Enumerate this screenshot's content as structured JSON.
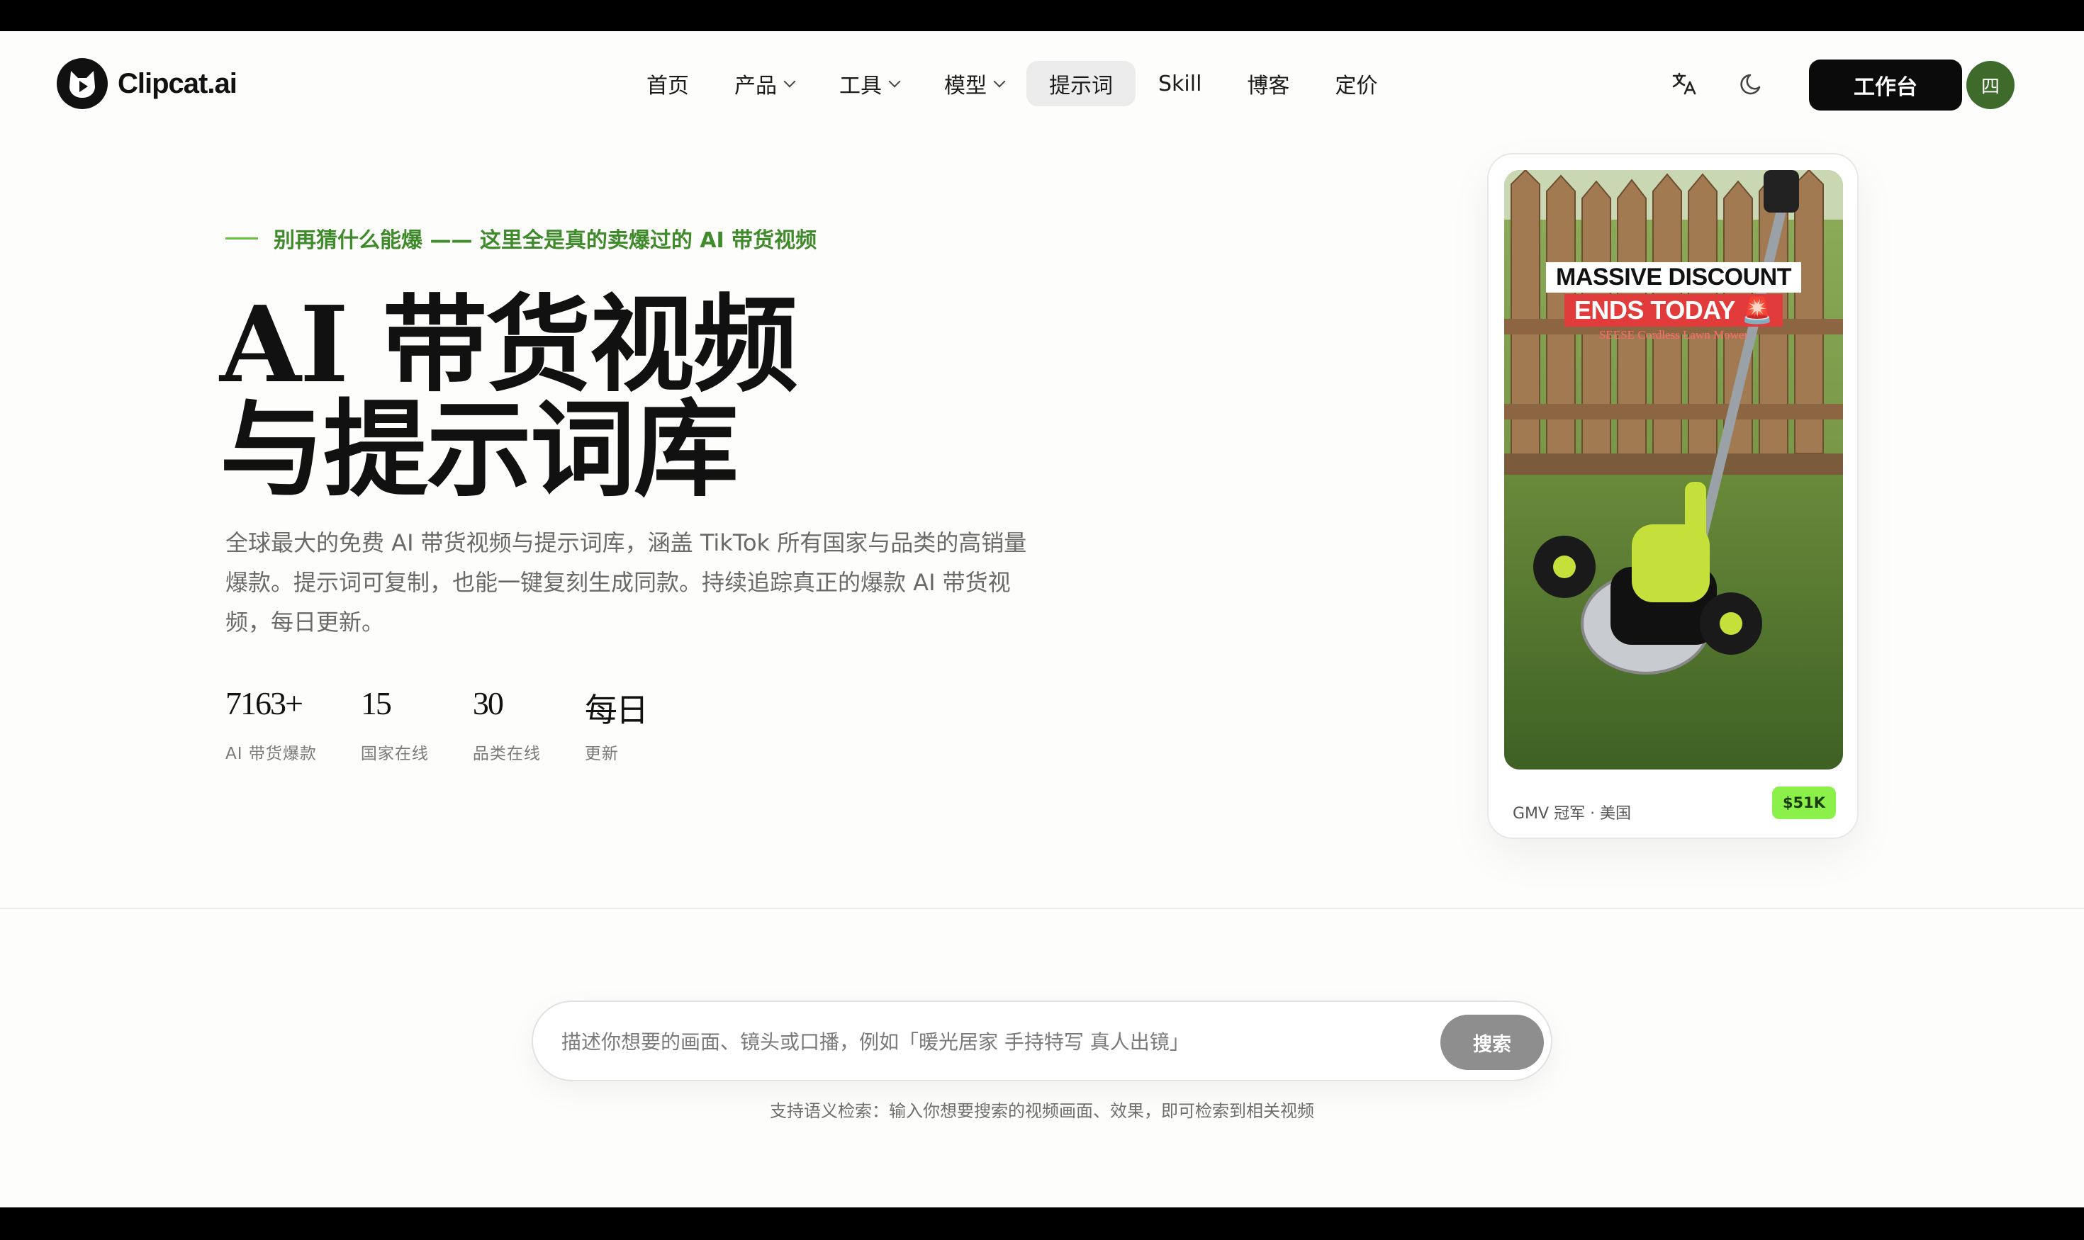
{
  "brand": {
    "name": "Clipcat.ai"
  },
  "nav": {
    "items": [
      {
        "label": "首页",
        "dropdown": false,
        "active": false
      },
      {
        "label": "产品",
        "dropdown": true,
        "active": false
      },
      {
        "label": "工具",
        "dropdown": true,
        "active": false
      },
      {
        "label": "模型",
        "dropdown": true,
        "active": false
      },
      {
        "label": "提示词",
        "dropdown": false,
        "active": true
      },
      {
        "label": "Skill",
        "dropdown": false,
        "active": false
      },
      {
        "label": "博客",
        "dropdown": false,
        "active": false
      },
      {
        "label": "定价",
        "dropdown": false,
        "active": false
      }
    ]
  },
  "header": {
    "icons": [
      "translate-icon",
      "moon-icon"
    ],
    "workbench_label": "工作台",
    "avatar_text": "四"
  },
  "hero": {
    "eyebrow": "别再猜什么能爆 —— 这里全是真的卖爆过的 AI 带货视频",
    "title_line1": "AI 带货视频",
    "title_line2": "与提示词库",
    "description": "全球最大的免费 AI 带货视频与提示词库，涵盖 TikTok 所有国家与品类的高销量爆款。提示词可复制，也能一键复刻生成同款。持续追踪真正的爆款 AI 带货视频，每日更新。",
    "stats": [
      {
        "value": "7163+",
        "label": "AI 带货爆款"
      },
      {
        "value": "15",
        "label": "国家在线"
      },
      {
        "value": "30",
        "label": "品类在线"
      },
      {
        "value": "每日",
        "label": "更新"
      }
    ]
  },
  "video_card": {
    "overlay_line1": "MASSIVE DISCOUNT",
    "overlay_line2": "ENDS TODAY 🚨",
    "overlay_line3": "SEESE Cordless Lawn Mower",
    "meta": "GMV 冠军 · 美国",
    "badge": "$51K",
    "badge_color": "#8bf04a"
  },
  "search": {
    "placeholder": "描述你想要的画面、镜头或口播，例如「暖光居家 手持特写 真人出镜」",
    "value": "",
    "button_label": "搜索",
    "hint": "支持语义检索：输入你想要搜索的视频画面、效果，即可检索到相关视频"
  },
  "colors": {
    "accent_green": "#3f8a2b",
    "avatar_bg": "#3e6b2b",
    "button_dark": "#0b0b0b"
  }
}
